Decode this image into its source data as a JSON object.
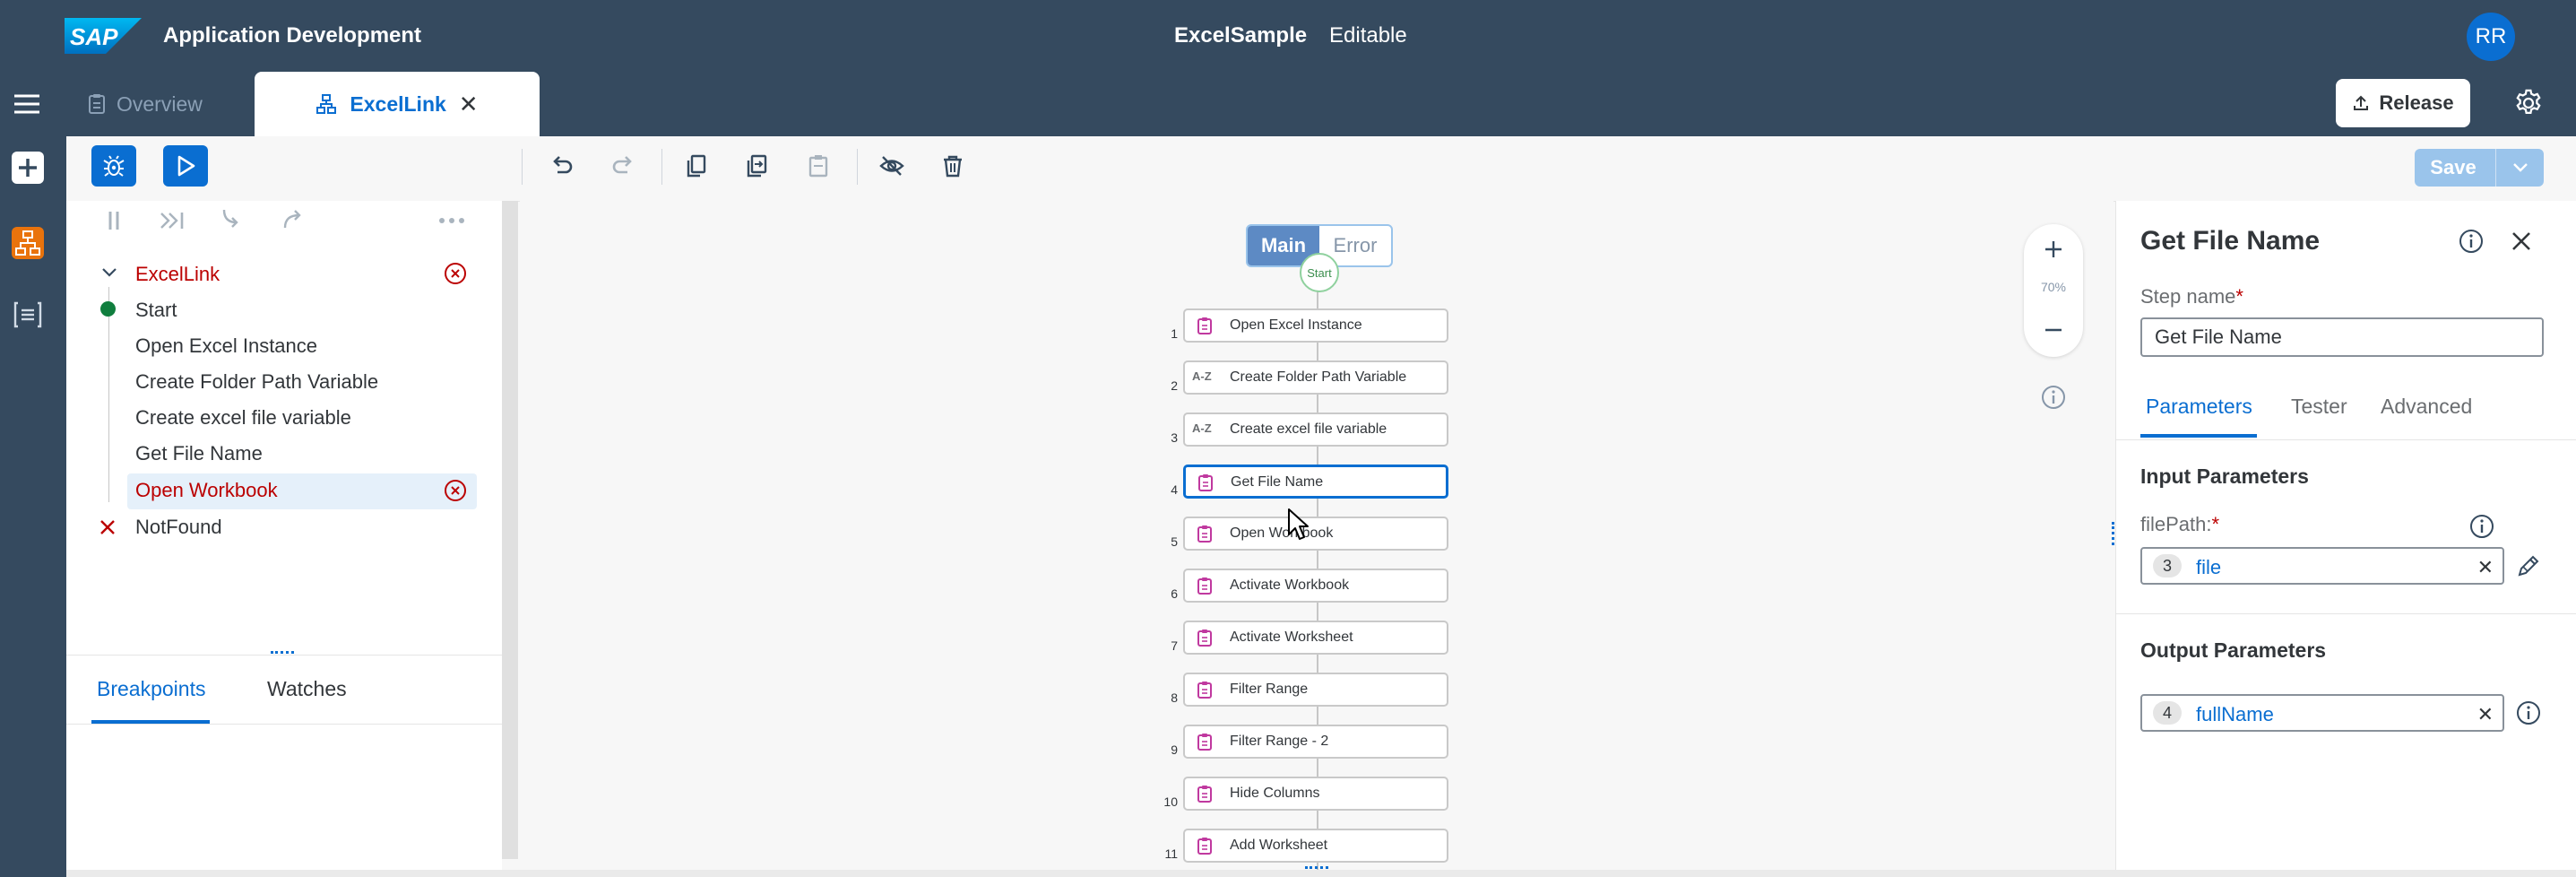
{
  "header": {
    "logo_text": "SAP",
    "app_title": "Application Development",
    "doc_title": "ExcelSample",
    "doc_status": "Editable",
    "avatar_initials": "RR",
    "brand_color": "#354a5f",
    "accent_color": "#0a6ed1"
  },
  "tabs": {
    "overview": "Overview",
    "active": "ExcelLink",
    "release_label": "Release"
  },
  "toolbar": {
    "save_label": "Save"
  },
  "tree": {
    "root": "ExcelLink",
    "items": [
      "Start",
      "Open Excel Instance",
      "Create Folder Path Variable",
      "Create excel file variable",
      "Get File Name",
      "Open Workbook",
      "NotFound"
    ]
  },
  "bottom_tabs": {
    "breakpoints": "Breakpoints",
    "watches": "Watches"
  },
  "canvas": {
    "segment_main": "Main",
    "segment_error": "Error",
    "start_label": "Start",
    "zoom": "70%",
    "steps": [
      {
        "num": "1",
        "label": "Open Excel Instance",
        "icon": "clipboard-icon"
      },
      {
        "num": "2",
        "label": "Create Folder Path Variable",
        "icon": "az-icon"
      },
      {
        "num": "3",
        "label": "Create excel file variable",
        "icon": "az-icon"
      },
      {
        "num": "4",
        "label": "Get File Name",
        "icon": "clipboard-icon"
      },
      {
        "num": "5",
        "label": "Open Workbook",
        "icon": "clipboard-icon"
      },
      {
        "num": "6",
        "label": "Activate Workbook",
        "icon": "clipboard-icon"
      },
      {
        "num": "7",
        "label": "Activate Worksheet",
        "icon": "clipboard-icon"
      },
      {
        "num": "8",
        "label": "Filter Range",
        "icon": "clipboard-icon"
      },
      {
        "num": "9",
        "label": "Filter Range - 2",
        "icon": "clipboard-icon"
      },
      {
        "num": "10",
        "label": "Hide Columns",
        "icon": "clipboard-icon"
      },
      {
        "num": "11",
        "label": "Add Worksheet",
        "icon": "clipboard-icon"
      }
    ]
  },
  "properties": {
    "title": "Get File Name",
    "step_name_label": "Step name",
    "step_name_value": "Get File Name",
    "tabs": [
      "Parameters",
      "Tester",
      "Advanced"
    ],
    "input_title": "Input Parameters",
    "input_param_label": "filePath:",
    "input_param_badge": "3",
    "input_param_value": "file",
    "output_title": "Output Parameters",
    "output_param_badge": "4",
    "output_param_value": "fullName"
  }
}
